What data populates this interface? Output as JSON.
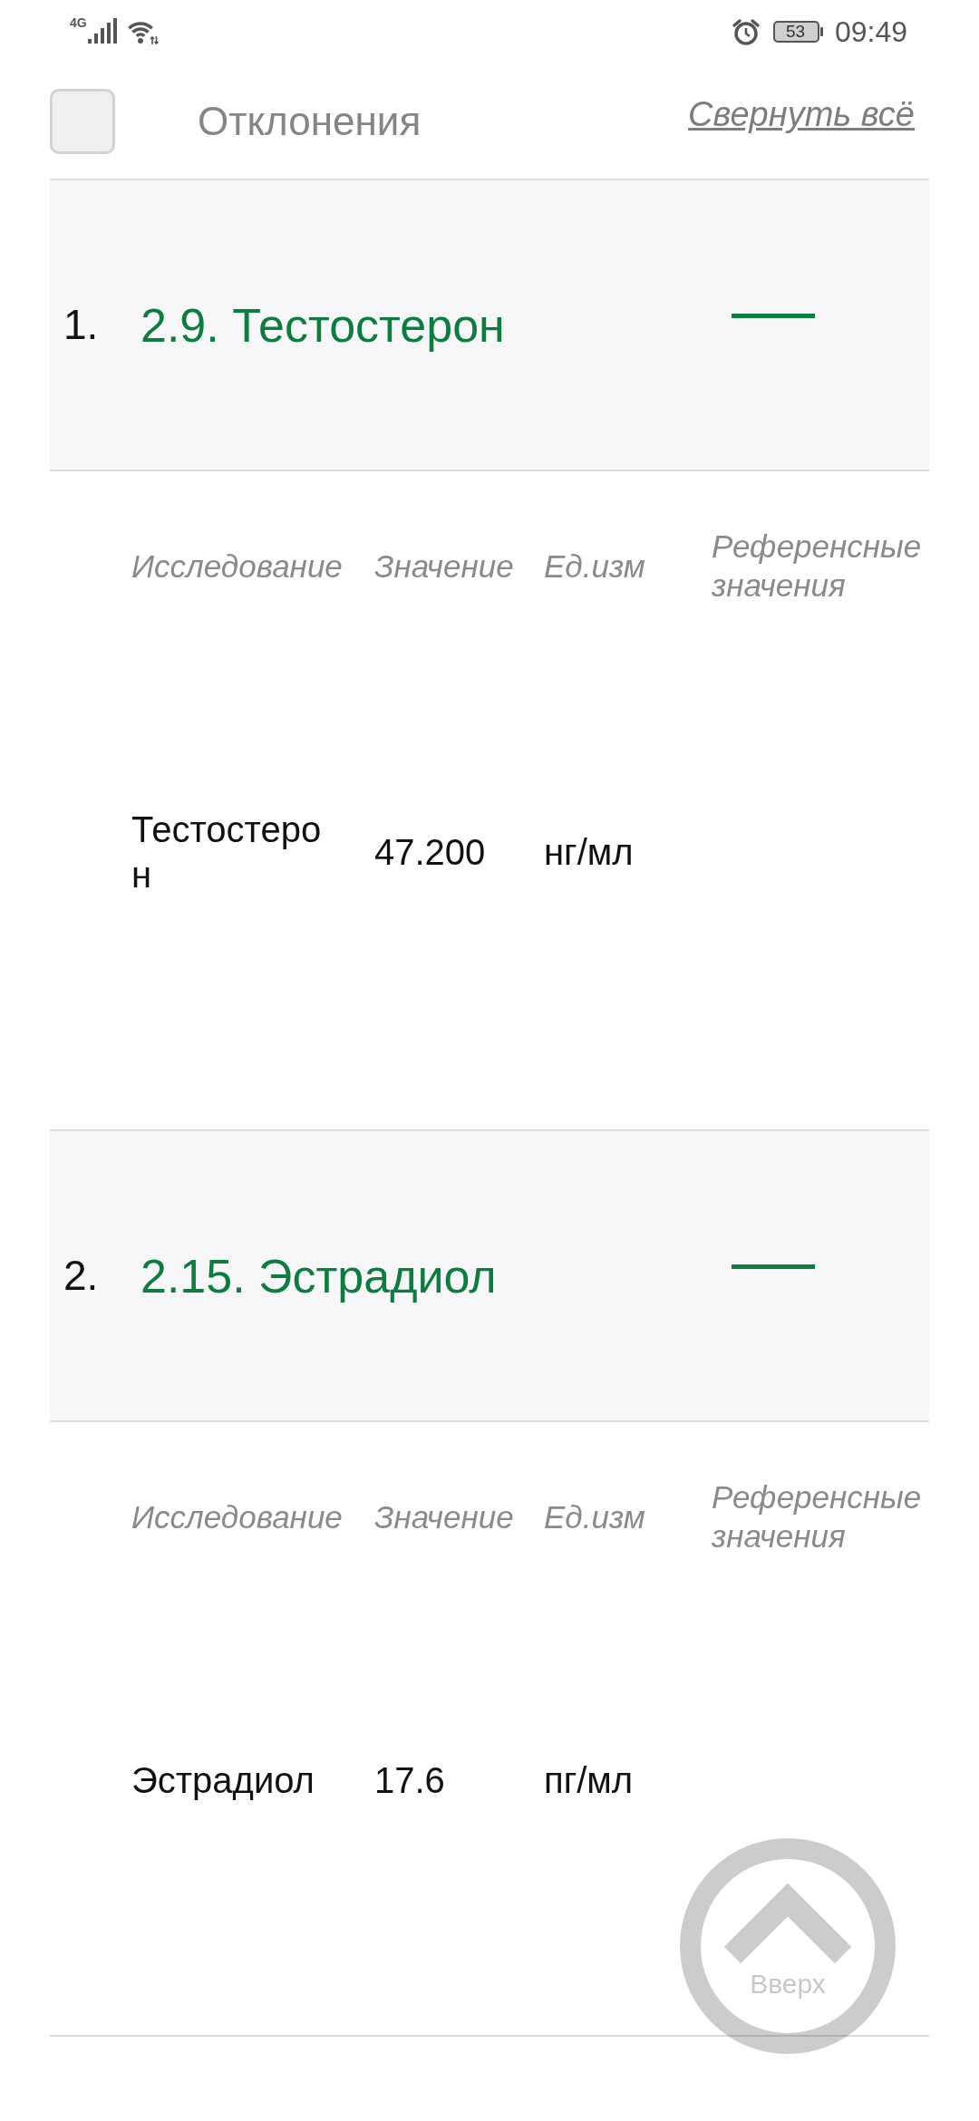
{
  "status_bar": {
    "network": "4G",
    "battery": "53",
    "time": "09:49"
  },
  "deviations_filter": {
    "label": "Отклонения",
    "checked": false
  },
  "collapse_all_link": "Свернуть всё",
  "sections": [
    {
      "number": "1.",
      "title": "2.9. Тестостерон",
      "expanded": true,
      "columns": [
        "Исследование",
        "Значение",
        "Ед.изм",
        "Референсные значения"
      ],
      "rows": [
        {
          "test": "Тестостерон",
          "value": "47.200",
          "unit": "нг/мл"
        }
      ]
    },
    {
      "number": "2.",
      "title": "2.15. Эстрадиол",
      "expanded": true,
      "columns": [
        "Исследование",
        "Значение",
        "Ед.изм",
        "Референсные значения"
      ],
      "rows": [
        {
          "test": "Эстрадиол",
          "value": "17.6",
          "unit": "пг/мл"
        }
      ]
    }
  ],
  "scroll_top_button": {
    "label": "Вверх"
  }
}
